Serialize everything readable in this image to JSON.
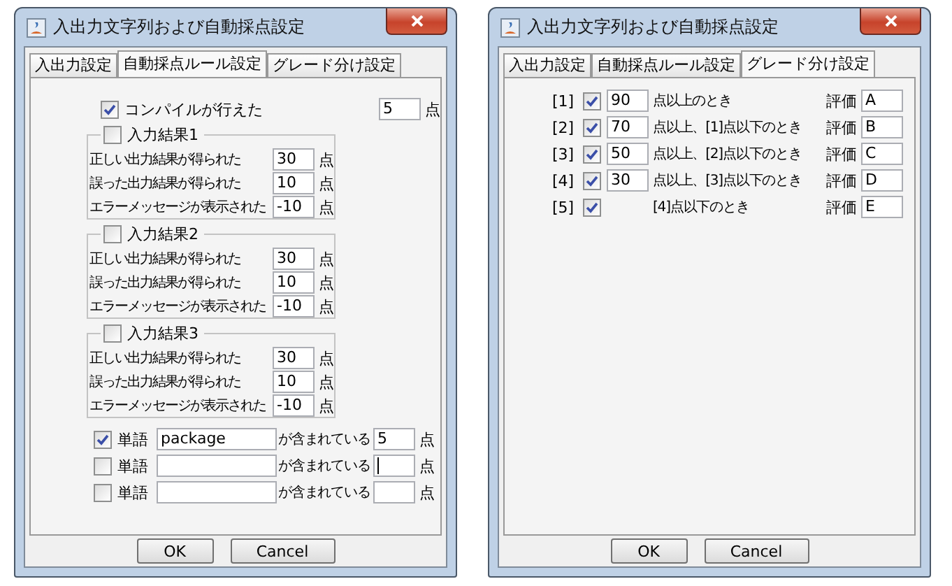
{
  "dialogs": [
    {
      "title": "入出力文字列および自動採点設定",
      "tabs": [
        {
          "label": "入出力設定",
          "selected": false
        },
        {
          "label": "自動採点ルール設定",
          "selected": true
        },
        {
          "label": "グレード分け設定",
          "selected": false
        }
      ],
      "panel": {
        "kind": "rules",
        "compile": {
          "checked": true,
          "label": "コンパイルが行えた",
          "value": "5",
          "unit": "点"
        },
        "groups": [
          {
            "checked": false,
            "title": "入力結果1",
            "rows": [
              {
                "label": "正しい出力結果が得られた",
                "value": "30",
                "unit": "点"
              },
              {
                "label": "誤った出力結果が得られた",
                "value": "10",
                "unit": "点"
              },
              {
                "label": "エラーメッセージが表示された",
                "value": "-10",
                "unit": "点"
              }
            ]
          },
          {
            "checked": false,
            "title": "入力結果2",
            "rows": [
              {
                "label": "正しい出力結果が得られた",
                "value": "30",
                "unit": "点"
              },
              {
                "label": "誤った出力結果が得られた",
                "value": "10",
                "unit": "点"
              },
              {
                "label": "エラーメッセージが表示された",
                "value": "-10",
                "unit": "点"
              }
            ]
          },
          {
            "checked": false,
            "title": "入力結果3",
            "rows": [
              {
                "label": "正しい出力結果が得られた",
                "value": "30",
                "unit": "点"
              },
              {
                "label": "誤った出力結果が得られた",
                "value": "10",
                "unit": "点"
              },
              {
                "label": "エラーメッセージが表示された",
                "value": "-10",
                "unit": "点"
              }
            ]
          }
        ],
        "words": [
          {
            "checked": true,
            "label": "単語",
            "value": "package",
            "suffix": "が含まれている",
            "points": "5",
            "focused": false,
            "unit": "点"
          },
          {
            "checked": false,
            "label": "単語",
            "suffix": "が含まれている",
            "focused": true,
            "unit": "点"
          },
          {
            "checked": false,
            "label": "単語",
            "suffix": "が含まれている",
            "focused": false,
            "unit": "点"
          }
        ]
      },
      "buttons": [
        "OK",
        "Cancel"
      ]
    },
    {
      "title": "入出力文字列および自動採点設定",
      "tabs": [
        {
          "label": "入出力設定",
          "selected": false
        },
        {
          "label": "自動採点ルール設定",
          "selected": false
        },
        {
          "label": "グレード分け設定",
          "selected": true
        }
      ],
      "panel": {
        "kind": "grades",
        "rows": [
          {
            "index": "[1]",
            "checked": true,
            "value": "90",
            "condition": "点以上のとき",
            "grade_label": "評価",
            "grade": "A"
          },
          {
            "index": "[2]",
            "checked": true,
            "value": "70",
            "condition": "点以上、[1]点以下のとき",
            "grade_label": "評価",
            "grade": "B"
          },
          {
            "index": "[3]",
            "checked": true,
            "value": "50",
            "condition": "点以上、[2]点以下のとき",
            "grade_label": "評価",
            "grade": "C"
          },
          {
            "index": "[4]",
            "checked": true,
            "value": "30",
            "condition": "点以上、[3]点以下のとき",
            "grade_label": "評価",
            "grade": "D"
          },
          {
            "index": "[5]",
            "checked": true,
            "condition": "[4]点以下のとき",
            "grade_label": "評価",
            "grade": "E"
          }
        ]
      },
      "buttons": [
        "OK",
        "Cancel"
      ]
    }
  ]
}
